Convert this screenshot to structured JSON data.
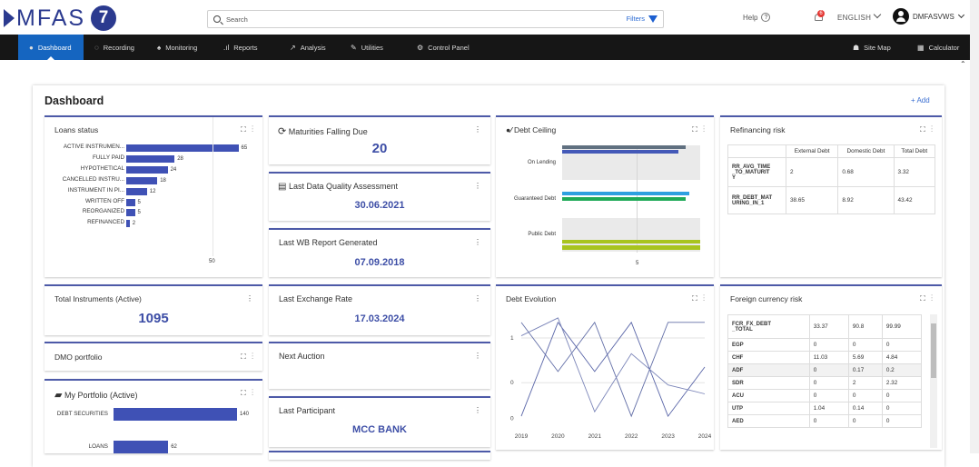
{
  "header": {
    "logo_text": "MFAS",
    "logo_number": "7",
    "search_placeholder": "Search",
    "filters_label": "Filters",
    "help_label": "Help",
    "notification_count": "6",
    "language": "ENGLISH",
    "username": "DMFASVWS"
  },
  "nav": {
    "items": [
      {
        "label": "Dashboard",
        "icon": "dashboard-icon"
      },
      {
        "label": "Recording",
        "icon": "recording-icon"
      },
      {
        "label": "Monitoring",
        "icon": "binoculars-icon"
      },
      {
        "label": "Reports",
        "icon": "reports-icon"
      },
      {
        "label": "Analysis",
        "icon": "analysis-icon"
      },
      {
        "label": "Utilities",
        "icon": "wrench-icon"
      },
      {
        "label": "Control Panel",
        "icon": "control-panel-icon"
      },
      {
        "label": "Site Map",
        "icon": "sitemap-icon"
      },
      {
        "label": "Calculator",
        "icon": "calculator-icon"
      }
    ]
  },
  "dashboard": {
    "title": "Dashboard",
    "add_label": "+ Add"
  },
  "loans_status": {
    "title": "Loans status",
    "axis_tick": "50",
    "chart_data": {
      "type": "bar",
      "categories": [
        "ACTIVE INSTRUMEN...",
        "FULLY PAID",
        "HYPOTHETICAL",
        "CANCELLED INSTRU...",
        "INSTRUMENT IN PI...",
        "WRITTEN OFF",
        "REORGANIZED",
        "REFINANCED"
      ],
      "values": [
        65,
        28,
        24,
        18,
        12,
        5,
        5,
        2
      ],
      "xlim": [
        0,
        70
      ]
    }
  },
  "maturities": {
    "title": "Maturities Falling Due",
    "value": "20"
  },
  "data_quality": {
    "title": "Last Data Quality Assessment",
    "value": "30.06.2021"
  },
  "wb_report": {
    "title": "Last WB Report Generated",
    "value": "07.09.2018"
  },
  "debt_ceiling": {
    "title": "Debt Ceiling",
    "axis_tick": "5",
    "chart_data": {
      "type": "bar",
      "categories": [
        "On Lending",
        "Guaranteed Debt",
        "Public Debt"
      ]
    }
  },
  "refinancing": {
    "title": "Refinancing risk",
    "columns": [
      "External Debt",
      "Domestic Debt",
      "Total Debt"
    ],
    "rows": [
      {
        "key": "RR_AVG_TIME_TO_MATURITY",
        "key_lines": [
          "RR_AVG_TIME",
          "_TO_MATURIT",
          "Y"
        ],
        "values": [
          "2",
          "0.68",
          "3.32"
        ]
      },
      {
        "key": "RR_DEBT_MATURING_IN_1",
        "key_lines": [
          "RR_DEBT_MAT",
          "URING_IN_1"
        ],
        "values": [
          "38.65",
          "8.92",
          "43.42"
        ]
      }
    ]
  },
  "total_instruments": {
    "title": "Total Instruments (Active)",
    "value": "1095"
  },
  "exchange_rate": {
    "title": "Last Exchange Rate",
    "value": "17.03.2024"
  },
  "debt_evolution": {
    "title": "Debt Evolution",
    "chart_data": {
      "type": "line",
      "x": [
        "2019",
        "2020",
        "2021",
        "2022",
        "2023",
        "2024"
      ],
      "yticks": [
        "0",
        "0",
        "1"
      ],
      "series": [
        {
          "values": [
            1.2,
            0.1,
            1.2,
            -0.9,
            1.2,
            1.2
          ]
        },
        {
          "values": [
            -0.9,
            1.2,
            0.1,
            1.2,
            -0.9,
            0.2
          ]
        },
        {
          "values": [
            0.9,
            1.3,
            -0.8,
            0.5,
            -0.2,
            -0.4
          ]
        }
      ]
    }
  },
  "fx_risk": {
    "title": "Foreign currency risk",
    "rows": [
      {
        "key": "FCR_FX_DEBT_TOTAL",
        "key_lines": [
          "FCR_FX_DEBT",
          "_TOTAL"
        ],
        "values": [
          "33.37",
          "90.8",
          "99.99"
        ]
      },
      {
        "key": "EGP",
        "values": [
          "0",
          "0",
          "0"
        ]
      },
      {
        "key": "CHF",
        "values": [
          "11.03",
          "5.69",
          "4.84"
        ]
      },
      {
        "key": "ADF",
        "values": [
          "0",
          "0.17",
          "0.2"
        ]
      },
      {
        "key": "SDR",
        "values": [
          "0",
          "2",
          "2.32"
        ]
      },
      {
        "key": "ACU",
        "values": [
          "0",
          "0",
          "0"
        ]
      },
      {
        "key": "UTP",
        "values": [
          "1.04",
          "0.14",
          "0"
        ]
      },
      {
        "key": "AED",
        "values": [
          "0",
          "0",
          "0"
        ]
      }
    ]
  },
  "dmo_portfolio": {
    "title": "DMO portfolio"
  },
  "next_auction": {
    "title": "Next Auction"
  },
  "my_portfolio": {
    "title": "My Portfolio (Active)",
    "chart_data": {
      "type": "bar",
      "categories": [
        "DEBT SECURITIES",
        "LOANS"
      ],
      "values": [
        140,
        62
      ],
      "xlim": [
        0,
        150
      ]
    }
  },
  "last_participant": {
    "title": "Last Participant",
    "value": "MCC BANK"
  }
}
